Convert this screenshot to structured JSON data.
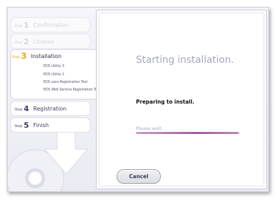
{
  "sidebar": {
    "step_word": "Step",
    "steps": [
      {
        "number": "1",
        "label": "Confirmation",
        "state": "inactive"
      },
      {
        "number": "2",
        "label": "License",
        "state": "inactive"
      },
      {
        "number": "3",
        "label": "Installation",
        "state": "active"
      },
      {
        "number": "4",
        "label": "Registration",
        "state": "pending"
      },
      {
        "number": "5",
        "label": "Finish",
        "state": "pending"
      }
    ],
    "install_items": [
      "EOS Utility 3",
      "EOS Utility 2",
      "EOS Lens Registration Tool",
      "EOS Web Service Registration Tool"
    ]
  },
  "main": {
    "title": "Starting installation.",
    "status": "Preparing to install.",
    "wait_text": "Please wait.",
    "progress_fraction": 0.99,
    "cancel_label": "Cancel"
  },
  "colors": {
    "active_step": "#f2a81d",
    "progress": "#9e58a1",
    "title": "#a4a8c0"
  }
}
